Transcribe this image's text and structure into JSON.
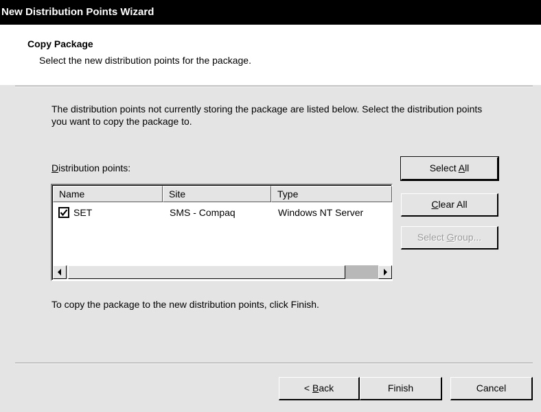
{
  "window": {
    "title": "New Distribution Points Wizard"
  },
  "header": {
    "title": "Copy Package",
    "subtitle": "Select the new distribution points for the package."
  },
  "intro_text": "The distribution points not currently storing the package are listed below. Select the distribution points you  want to copy the package to.",
  "list": {
    "label_prefix": "",
    "label_accel": "D",
    "label_rest": "istribution points:",
    "columns": [
      "Name",
      "Site",
      "Type"
    ],
    "rows": [
      {
        "checked": true,
        "name": "SET",
        "site": "SMS - Compaq",
        "type": "Windows NT Server"
      }
    ]
  },
  "side_buttons": {
    "select_all": {
      "before": "Select ",
      "accel": "A",
      "after": "ll"
    },
    "clear_all": {
      "before": "",
      "accel": "C",
      "after": "lear All"
    },
    "select_group": {
      "before": "Select ",
      "accel": "G",
      "after": "roup..."
    }
  },
  "finish_hint": "To copy the package to the new distribution points, click Finish.",
  "footer_buttons": {
    "back": {
      "before": "< ",
      "accel": "B",
      "after": "ack"
    },
    "finish": "Finish",
    "cancel": "Cancel"
  }
}
